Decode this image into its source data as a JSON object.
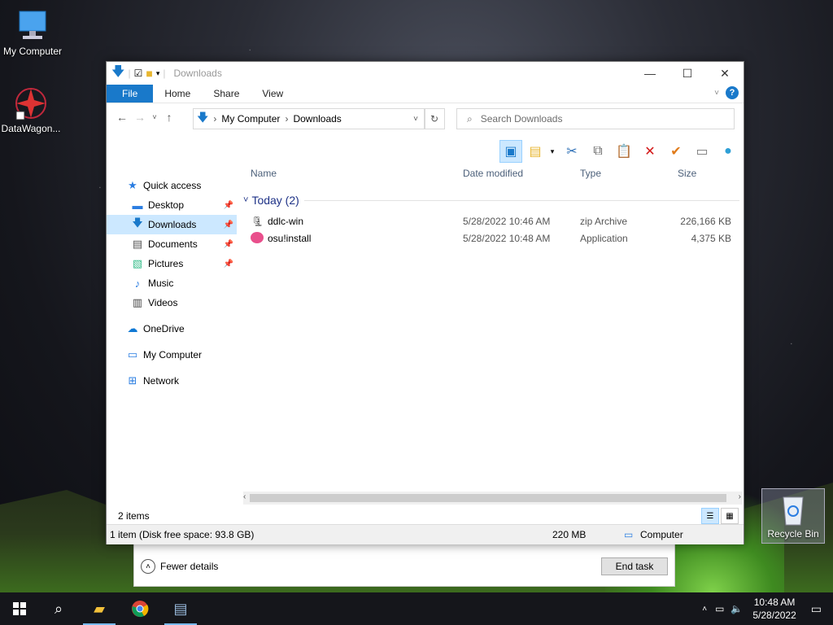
{
  "desktop": {
    "icons": [
      {
        "label": "My Computer"
      },
      {
        "label": "DataWagon..."
      },
      {
        "label": "Recycle Bin"
      }
    ]
  },
  "taskmgr": {
    "fewer_details": "Fewer details",
    "end_task": "End task"
  },
  "explorer": {
    "title": "Downloads",
    "ribbon_tabs": [
      "File",
      "Home",
      "Share",
      "View"
    ],
    "breadcrumb": [
      "My Computer",
      "Downloads"
    ],
    "search_placeholder": "Search Downloads",
    "sidebar": {
      "quick_access": "Quick access",
      "items": [
        {
          "label": "Desktop",
          "pinned": true
        },
        {
          "label": "Downloads",
          "pinned": true,
          "selected": true
        },
        {
          "label": "Documents",
          "pinned": true
        },
        {
          "label": "Pictures",
          "pinned": true
        },
        {
          "label": "Music",
          "pinned": false
        },
        {
          "label": "Videos",
          "pinned": false
        }
      ],
      "onedrive": "OneDrive",
      "my_computer": "My Computer",
      "network": "Network"
    },
    "columns": [
      "Name",
      "Date modified",
      "Type",
      "Size"
    ],
    "group": "Today (2)",
    "files": [
      {
        "name": "ddlc-win",
        "date": "5/28/2022 10:46 AM",
        "type": "zip Archive",
        "size": "226,166 KB"
      },
      {
        "name": "osu!install",
        "date": "5/28/2022 10:48 AM",
        "type": "Application",
        "size": "4,375 KB"
      }
    ],
    "status_items": "2 items",
    "bottom": {
      "disk": "1 item (Disk free space: 93.8 GB)",
      "size": "220 MB",
      "location": "Computer"
    }
  },
  "taskbar": {
    "time": "10:48 AM",
    "date": "5/28/2022"
  }
}
